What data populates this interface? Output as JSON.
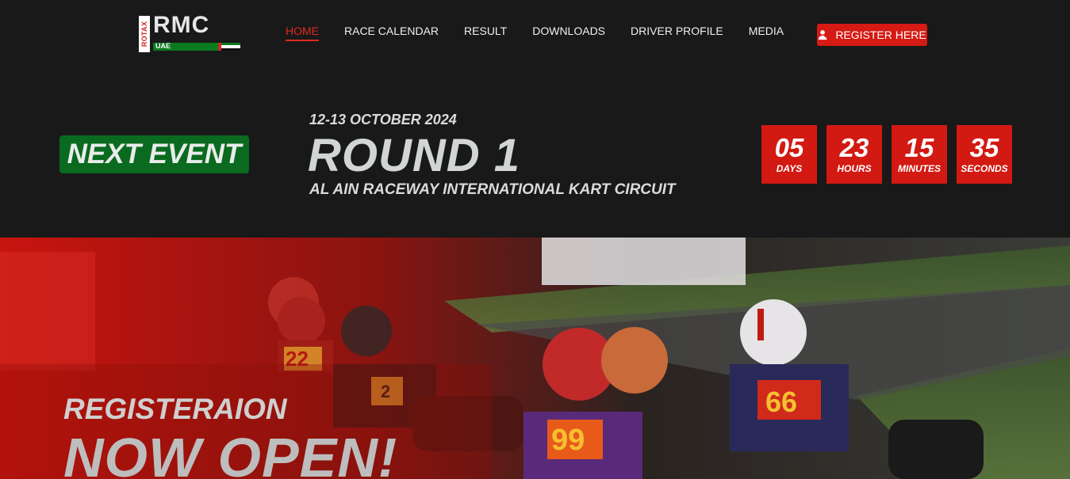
{
  "brand": {
    "logo_text": "RMC",
    "logo_side_text": "ROTAX",
    "logo_country": "UAE"
  },
  "nav": {
    "items": [
      "HOME",
      "RACE CALENDAR",
      "RESULT",
      "DOWNLOADS",
      "DRIVER PROFILE",
      "MEDIA"
    ],
    "active_index": 0
  },
  "register_button": {
    "label": "REGISTER HERE",
    "icon": "user-icon"
  },
  "next_event": {
    "badge": "NEXT EVENT",
    "date": "12-13 OCTOBER 2024",
    "title": "ROUND 1",
    "venue": "AL AIN RACEWAY INTERNATIONAL KART CIRCUIT"
  },
  "countdown": [
    {
      "value": "05",
      "label": "DAYS"
    },
    {
      "value": "23",
      "label": "HOURS"
    },
    {
      "value": "15",
      "label": "MINUTES"
    },
    {
      "value": "35",
      "label": "SECONDS"
    }
  ],
  "hero": {
    "subtitle": "REGISTERAION",
    "title": "NOW OPEN!",
    "kart_numbers": [
      "22",
      "2",
      "99",
      "66"
    ]
  },
  "colors": {
    "accent_red": "#d61a14",
    "brand_green": "#0a6a1f",
    "header_bg": "#19191a"
  }
}
